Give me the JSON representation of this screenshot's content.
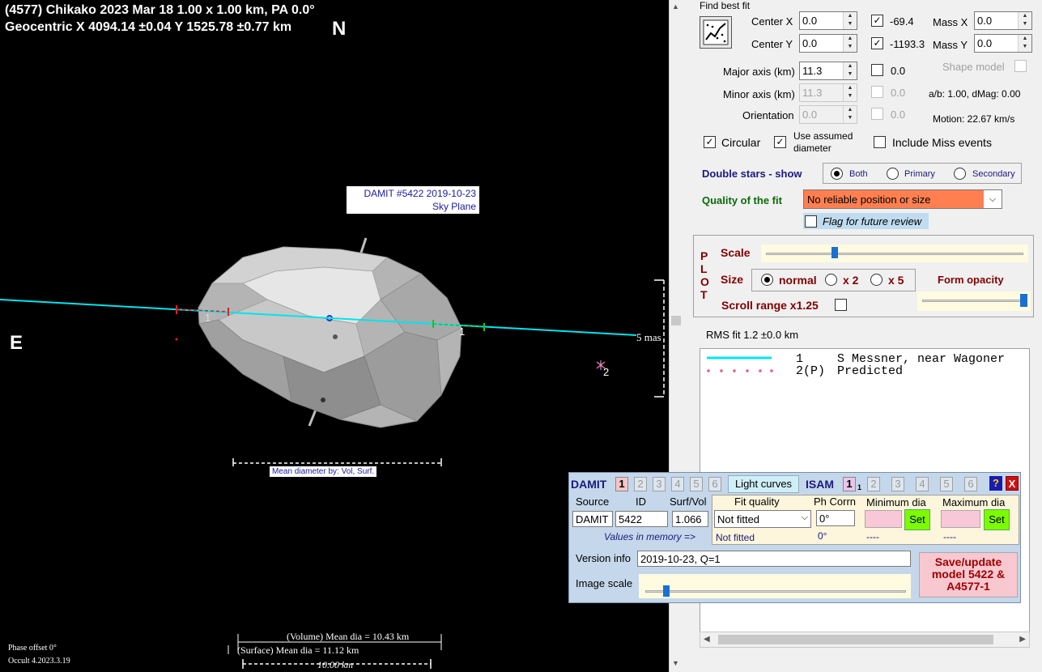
{
  "plot": {
    "title_line1": "(4577) Chikako  2023 Mar 18   1.00 x 1.00 km, PA 0.0°",
    "title_line2": "Geocentric  X  4094.14 ±0.04  Y 1525.78 ±0.77 km",
    "north_label": "N",
    "east_label": "E",
    "damit_label_1": "DAMIT #5422 2019-10-23",
    "damit_label_2": "Sky Plane",
    "chord_label_1a": "1",
    "chord_label_1b": "1",
    "chord_label_2": "2",
    "scale_mas": "5 mas",
    "mean_dia_caption": "Mean diameter by:  Vol,  Surf.",
    "vol_dia": "(Volume) Mean dia = 10.43 km",
    "surf_dia": "(Surface) Mean dia = 11.12 km",
    "scale_km": "10.00 km",
    "phase_offset": "Phase offset 0°",
    "version": "Occult 4.2023.3.19",
    "colors": {
      "background": "#000000",
      "chord": "#00e5ee",
      "predicted": "#e06080"
    }
  },
  "fit": {
    "find_best_fit": "Find best fit",
    "center_x_label": "Center X",
    "center_x": "0.0",
    "center_x_check": "-69.4",
    "center_y_label": "Center Y",
    "center_y": "0.0",
    "center_y_check": "-1193.3",
    "mass_x_label": "Mass X",
    "mass_x": "0.0",
    "mass_y_label": "Mass Y",
    "mass_y": "0.0",
    "major_label": "Major axis (km)",
    "major": "11.3",
    "major_check": "0.0",
    "minor_label": "Minor axis (km)",
    "minor": "11.3",
    "minor_check": "0.0",
    "orient_label": "Orientation",
    "orient": "0.0",
    "orient_check": "0.0",
    "shape_model": "Shape model",
    "ab_dmag": "a/b: 1.00, dMag: 0.00",
    "motion": "Motion: 22.67 km/s",
    "circular": "Circular",
    "use_assumed": "Use assumed",
    "diameter": "diameter",
    "include_miss": "Include Miss events",
    "double_stars": "Double stars - show",
    "both": "Both",
    "primary": "Primary",
    "secondary": "Secondary",
    "quality_label": "Quality of the fit",
    "quality_value": "No reliable position or size",
    "flag_review": "Flag for future review"
  },
  "plotopts": {
    "plot_vertical": "PLOT",
    "scale": "Scale",
    "size": "Size",
    "normal": "normal",
    "x2": "x 2",
    "x5": "x 5",
    "form_opacity": "Form opacity",
    "scroll_range": "Scroll range x1.25",
    "rms_fit": "RMS fit 1.2 ±0.0 km",
    "scale_slider": 0.27,
    "opacity_slider": 0.97
  },
  "legend": [
    {
      "num": "1",
      "text": "S Messner, near Wagoner"
    },
    {
      "num": "2(P)",
      "text": "Predicted"
    }
  ],
  "damit": {
    "damit_title": "DAMIT",
    "tabs": [
      "1",
      "2",
      "3",
      "4",
      "5",
      "6"
    ],
    "light_curves": "Light curves",
    "isam_title": "ISAM",
    "isam_sub": "1",
    "help": "?",
    "close": "X",
    "source_label": "Source",
    "id_label": "ID",
    "surfvol_label": "Surf/Vol",
    "source": "DAMIT",
    "id": "5422",
    "surfvol": "1.066",
    "fit_quality_label": "Fit quality",
    "ph_corrn_label": "Ph Corrn",
    "min_dia_label": "Minimum dia",
    "max_dia_label": "Maximum dia",
    "fit_quality": "Not fitted",
    "ph_corrn": "0°",
    "set": "Set",
    "values_memory": "Values in memory =>",
    "mem_fit": "Not fitted",
    "mem_ph": "0°",
    "mem_min": "----",
    "mem_max": "----",
    "version_label": "Version info",
    "version_value": "2019-10-23, Q=1",
    "image_scale_label": "Image scale",
    "image_scale": 0.09,
    "save_update": "Save/update model 5422 & A4577-1"
  }
}
